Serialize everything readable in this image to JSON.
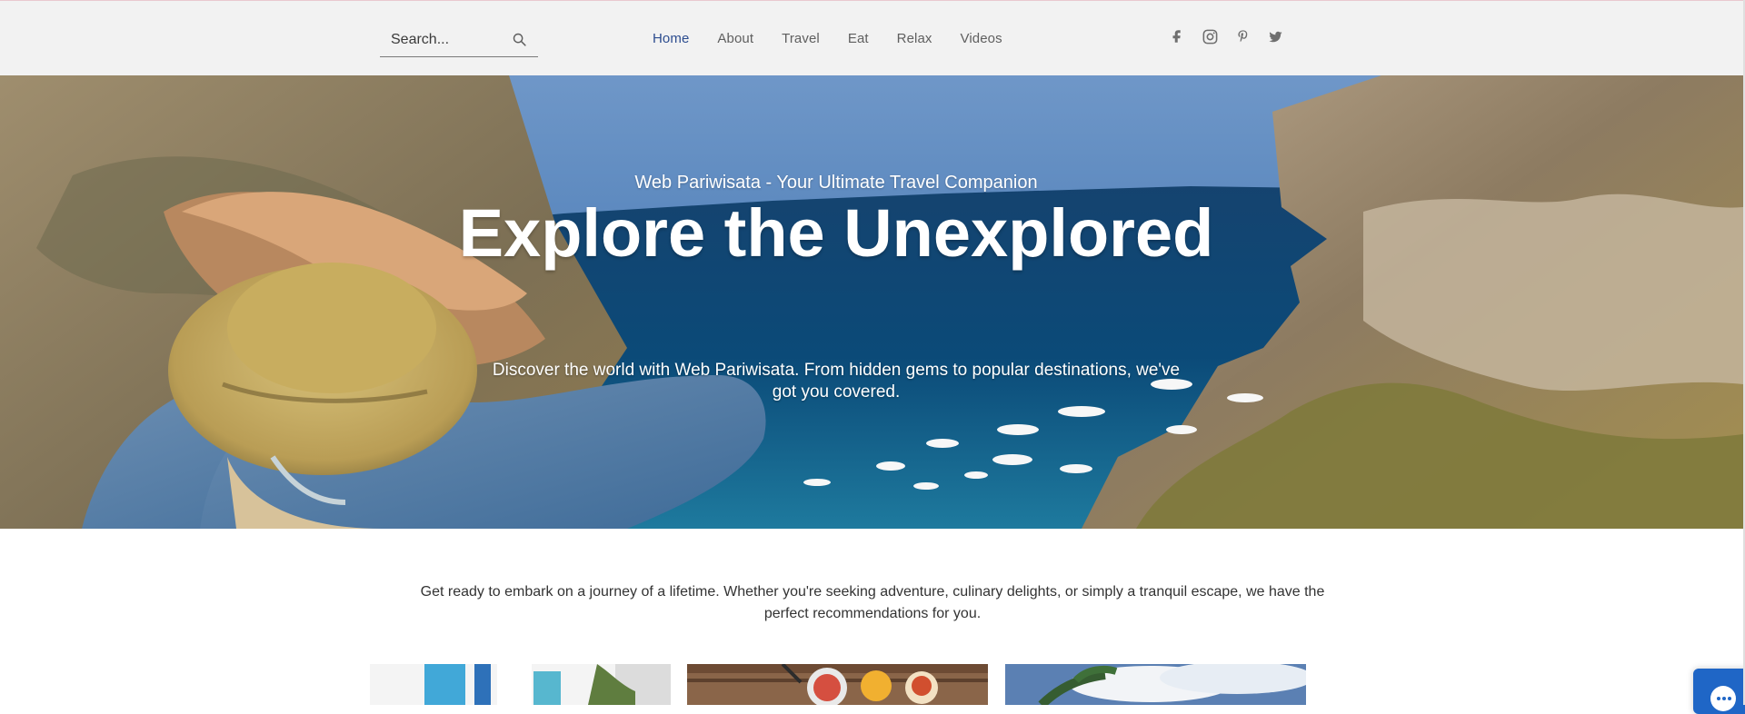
{
  "header": {
    "search": {
      "placeholder": "Search...",
      "icon": "search-icon"
    },
    "nav": {
      "items": [
        {
          "label": "Home",
          "active": true
        },
        {
          "label": "About",
          "active": false
        },
        {
          "label": "Travel",
          "active": false
        },
        {
          "label": "Eat",
          "active": false
        },
        {
          "label": "Relax",
          "active": false
        },
        {
          "label": "Videos",
          "active": false
        }
      ]
    },
    "social": [
      {
        "name": "facebook-icon"
      },
      {
        "name": "instagram-icon"
      },
      {
        "name": "pinterest-icon"
      },
      {
        "name": "twitter-icon"
      }
    ]
  },
  "hero": {
    "eyebrow": "Web Pariwisata - Your Ultimate Travel Companion",
    "headline": "Explore the Unexplored",
    "subhead": "Discover the world with Web Pariwisata. From hidden gems to popular destinations, we've got you covered."
  },
  "intro": {
    "text": "Get ready to embark on a journey of a lifetime. Whether you're seeking adventure, culinary delights, or simply a tranquil escape, we have the perfect recommendations for you."
  },
  "cards": [
    {
      "name": "card-travel"
    },
    {
      "name": "card-eat"
    },
    {
      "name": "card-relax"
    }
  ],
  "colors": {
    "header_bg": "#f2f2f2",
    "nav_active": "#2d4d8f",
    "nav_text": "#5f5f5f",
    "chat_blue": "#1f66c6"
  }
}
